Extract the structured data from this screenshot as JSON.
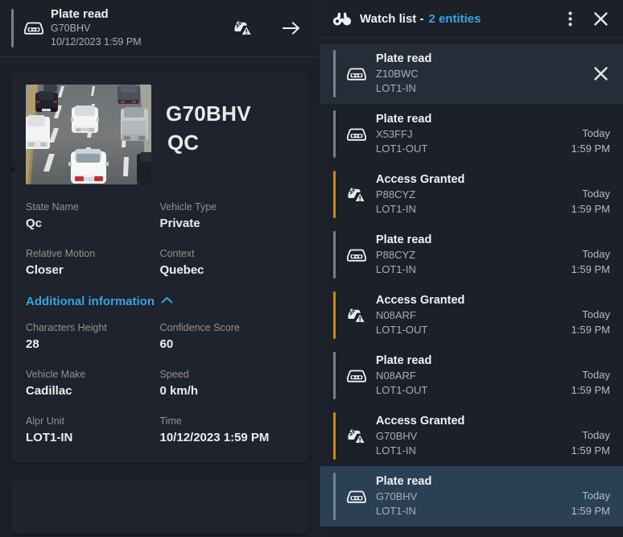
{
  "colors": {
    "page_bg": "#1b2029",
    "card_bg": "#1e232d",
    "accent_blue": "#3aa4dd",
    "accent_amber": "#c98a1c",
    "bar_gray": "#7a818c",
    "selected_row": "#2a4055",
    "highlight_row": "#272d38",
    "label_tan": "#9a9187"
  },
  "left_panel": {
    "event_header": {
      "icon": "license-plate-car-icon",
      "title": "Plate read",
      "plate": "G70BHV",
      "timestamp": "10/12/2023 1:59 PM",
      "alert_icon": "car-warning-icon",
      "forward_icon": "arrow-right-icon"
    },
    "detail_card": {
      "thumbnail_alt": "traffic-camera-snapshot",
      "plate_number": "G70BHV",
      "plate_state": "QC",
      "fields": [
        {
          "label": "State Name",
          "value": "Qc"
        },
        {
          "label": "Vehicle Type",
          "value": "Private"
        },
        {
          "label": "Relative Motion",
          "value": "Closer"
        },
        {
          "label": "Context",
          "value": "Quebec"
        }
      ],
      "additional_information": {
        "label": "Additional information",
        "chevron_icon": "chevron-up-icon",
        "expanded": true,
        "fields": [
          {
            "label": "Characters Height",
            "value": "28"
          },
          {
            "label": "Confidence Score",
            "value": "60"
          },
          {
            "label": "Vehicle Make",
            "value": "Cadillac"
          },
          {
            "label": "Speed",
            "value": "0 km/h"
          },
          {
            "label": "Alpr Unit",
            "value": "LOT1-IN"
          },
          {
            "label": "Time",
            "value": "10/12/2023 1:59 PM"
          }
        ]
      }
    }
  },
  "right_panel": {
    "header": {
      "icon": "binoculars-icon",
      "title": "Watch list -",
      "count_label": "2 entities",
      "menu_icon": "kebab-menu-icon",
      "close_icon": "close-icon"
    },
    "items": [
      {
        "title": "Plate read",
        "plate": "Z10BWC",
        "unit": "LOT1-IN",
        "day": "",
        "time": "",
        "icon": "license-plate-car-icon",
        "bar": "gray",
        "state": "highlight",
        "has_close": true,
        "close_icon": "close-icon"
      },
      {
        "title": "Plate read",
        "plate": "X53FFJ",
        "unit": "LOT1-OUT",
        "day": "Today",
        "time": "1:59 PM",
        "icon": "license-plate-car-icon",
        "bar": "gray",
        "state": "normal",
        "has_close": false
      },
      {
        "title": "Access Granted",
        "plate": "P88CYZ",
        "unit": "LOT1-IN",
        "day": "Today",
        "time": "1:59 PM",
        "icon": "car-warning-icon",
        "bar": "amber",
        "state": "normal",
        "has_close": false
      },
      {
        "title": "Plate read",
        "plate": "P88CYZ",
        "unit": "LOT1-IN",
        "day": "Today",
        "time": "1:59 PM",
        "icon": "license-plate-car-icon",
        "bar": "gray",
        "state": "normal",
        "has_close": false
      },
      {
        "title": "Access Granted",
        "plate": "N08ARF",
        "unit": "LOT1-OUT",
        "day": "Today",
        "time": "1:59 PM",
        "icon": "car-warning-icon",
        "bar": "amber",
        "state": "normal",
        "has_close": false
      },
      {
        "title": "Plate read",
        "plate": "N08ARF",
        "unit": "LOT1-OUT",
        "day": "Today",
        "time": "1:59 PM",
        "icon": "license-plate-car-icon",
        "bar": "gray",
        "state": "normal",
        "has_close": false
      },
      {
        "title": "Access Granted",
        "plate": "G70BHV",
        "unit": "LOT1-IN",
        "day": "Today",
        "time": "1:59 PM",
        "icon": "car-warning-icon",
        "bar": "amber",
        "state": "normal",
        "has_close": false
      },
      {
        "title": "Plate read",
        "plate": "G70BHV",
        "unit": "LOT1-IN",
        "day": "Today",
        "time": "1:59 PM",
        "icon": "license-plate-car-icon",
        "bar": "gray",
        "state": "selected",
        "has_close": false
      }
    ]
  }
}
